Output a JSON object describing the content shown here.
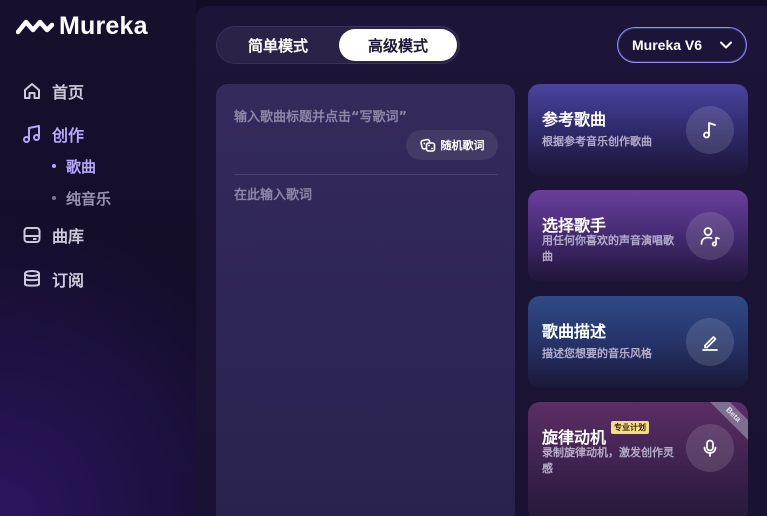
{
  "brand": {
    "name": "Mureka"
  },
  "nav": {
    "home": "首页",
    "create": "创作",
    "create_sub": [
      "歌曲",
      "纯音乐"
    ],
    "library": "曲库",
    "subscribe": "订阅"
  },
  "mode": {
    "simple": "简单模式",
    "advanced": "高级模式",
    "selected": "高级模式"
  },
  "model": {
    "selected": "Mureka V6"
  },
  "editor": {
    "title_placeholder": "输入歌曲标题并点击“写歌词”",
    "random_lyrics_label": "随机歌词",
    "lyrics_placeholder": "在此输入歌词"
  },
  "cards": [
    {
      "title": "参考歌曲",
      "desc": "根据参考音乐创作歌曲",
      "icon": "music-note-icon"
    },
    {
      "title": "选择歌手",
      "desc": "用任何你喜欢的声音演唱歌曲",
      "icon": "singer-icon"
    },
    {
      "title": "歌曲描述",
      "desc": "描述您想要的音乐风格",
      "icon": "pencil-icon"
    },
    {
      "title": "旋律动机",
      "badge": "专业计划",
      "ribbon": "Beta",
      "desc": "录制旋律动机，激发创作灵感",
      "icon": "microphone-icon"
    }
  ],
  "colors": {
    "accent": "#b8a6ff",
    "background": "#140c24",
    "panel": "#1d1538"
  }
}
